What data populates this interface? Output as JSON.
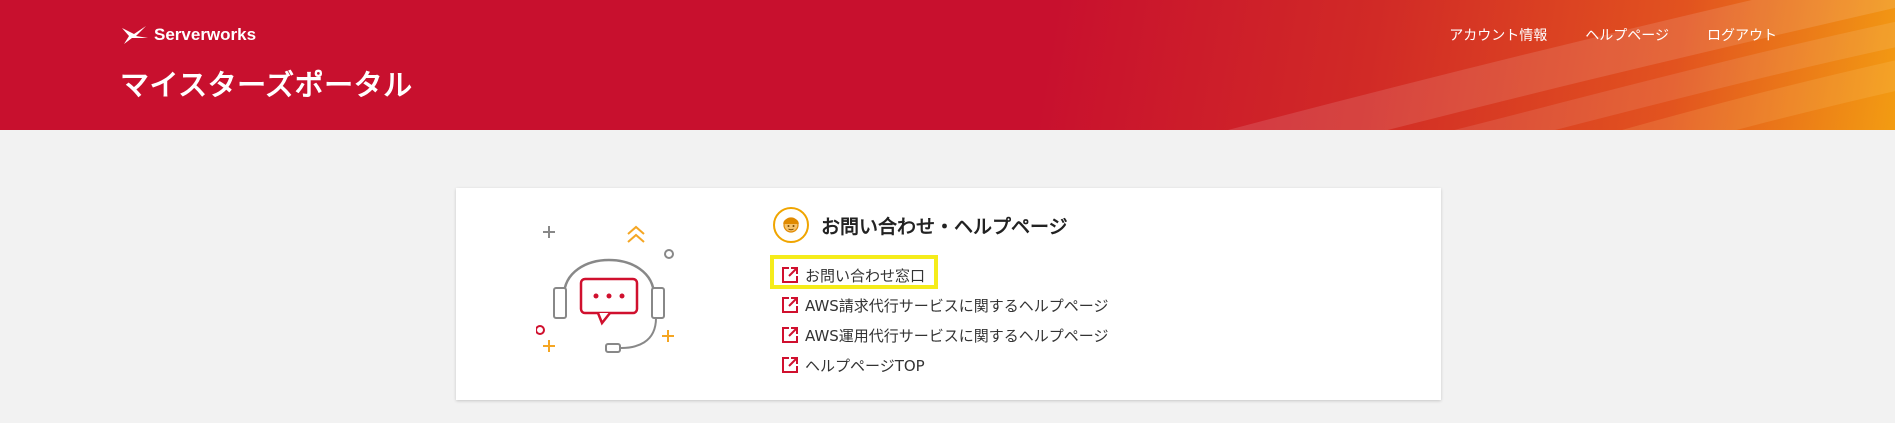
{
  "header": {
    "brand": "Serverworks",
    "portal_title": "マイスターズポータル",
    "nav": [
      {
        "label": "アカウント情報"
      },
      {
        "label": "ヘルプページ"
      },
      {
        "label": "ログアウト"
      }
    ],
    "colors": {
      "primary": "#c8102e",
      "accent": "#f39c12"
    }
  },
  "card": {
    "title": "お問い合わせ・ヘルプページ",
    "title_icon": "support-agent-icon",
    "illustration": "headset-chat-icon",
    "links": [
      {
        "label": "お問い合わせ窓口",
        "icon": "external-link-icon",
        "highlighted": true
      },
      {
        "label": "AWS請求代行サービスに関するヘルプページ",
        "icon": "external-link-icon"
      },
      {
        "label": "AWS運用代行サービスに関するヘルプページ",
        "icon": "external-link-icon"
      },
      {
        "label": "ヘルプページTOP",
        "icon": "external-link-icon"
      }
    ]
  }
}
